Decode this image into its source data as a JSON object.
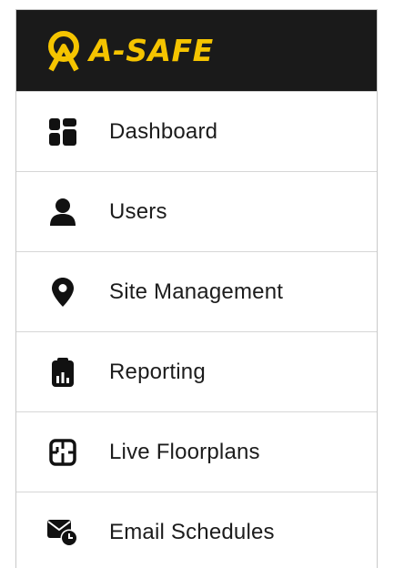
{
  "brand": {
    "name": "A-SAFE",
    "accent_color": "#f5c400",
    "header_background": "#1a1a1a"
  },
  "nav": {
    "items": [
      {
        "label": "Dashboard",
        "icon": "dashboard-icon"
      },
      {
        "label": "Users",
        "icon": "user-icon"
      },
      {
        "label": "Site Management",
        "icon": "location-pin-icon"
      },
      {
        "label": "Reporting",
        "icon": "report-clipboard-icon"
      },
      {
        "label": "Live Floorplans",
        "icon": "floorplan-icon"
      },
      {
        "label": "Email Schedules",
        "icon": "email-schedule-icon"
      }
    ]
  }
}
